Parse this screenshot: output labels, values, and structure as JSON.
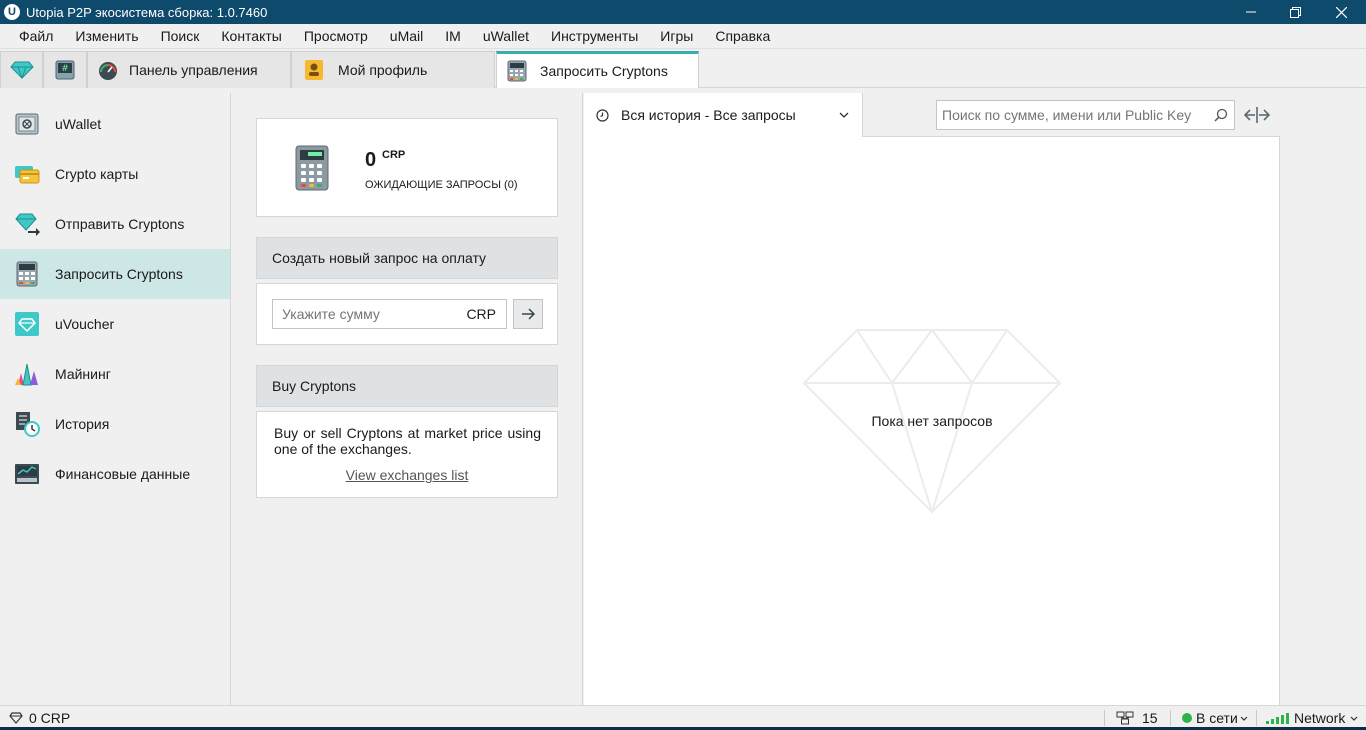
{
  "window": {
    "title": "Utopia P2P экосистема сборка: 1.0.7460"
  },
  "menu": [
    "Файл",
    "Изменить",
    "Поиск",
    "Контакты",
    "Просмотр",
    "uMail",
    "IM",
    "uWallet",
    "Инструменты",
    "Игры",
    "Справка"
  ],
  "tabs": [
    {
      "label": "Панель управления"
    },
    {
      "label": "Мой профиль"
    },
    {
      "label": "Запросить Cryptons"
    }
  ],
  "sidebar": {
    "items": [
      {
        "label": "uWallet",
        "icon": "safe-icon"
      },
      {
        "label": "Crypto карты",
        "icon": "crypto-cards-icon"
      },
      {
        "label": "Отправить Cryptons",
        "icon": "send-crystal-icon"
      },
      {
        "label": "Запросить Cryptons",
        "icon": "calculator-icon"
      },
      {
        "label": "uVoucher",
        "icon": "voucher-icon"
      },
      {
        "label": "Майнинг",
        "icon": "mining-crystals-icon"
      },
      {
        "label": "История",
        "icon": "history-icon"
      },
      {
        "label": "Финансовые данные",
        "icon": "financial-data-icon"
      }
    ]
  },
  "summary": {
    "amount": "0",
    "currency": "CRP",
    "pending": "ОЖИДАЮЩИЕ ЗАПРОСЫ (0)"
  },
  "new_request": {
    "title": "Создать новый запрос на оплату",
    "placeholder": "Укажите сумму",
    "currency": "CRP"
  },
  "buy": {
    "title": "Buy Cryptons",
    "text": "Buy or sell Cryptons at market price using one of the exchanges.",
    "link": "View exchanges list"
  },
  "history": {
    "filter": "Вся история - Все запросы",
    "search_placeholder": "Поиск по сумме, имени или Public Key",
    "empty": "Пока нет запросов"
  },
  "status": {
    "balance": "0 CRP",
    "peers": "15",
    "online": "В сети",
    "network": "Network"
  },
  "colors": {
    "titlebar": "#0e4a6b",
    "accent": "#3aaeae",
    "active_item": "#cde6e6",
    "online": "#2db34a"
  }
}
